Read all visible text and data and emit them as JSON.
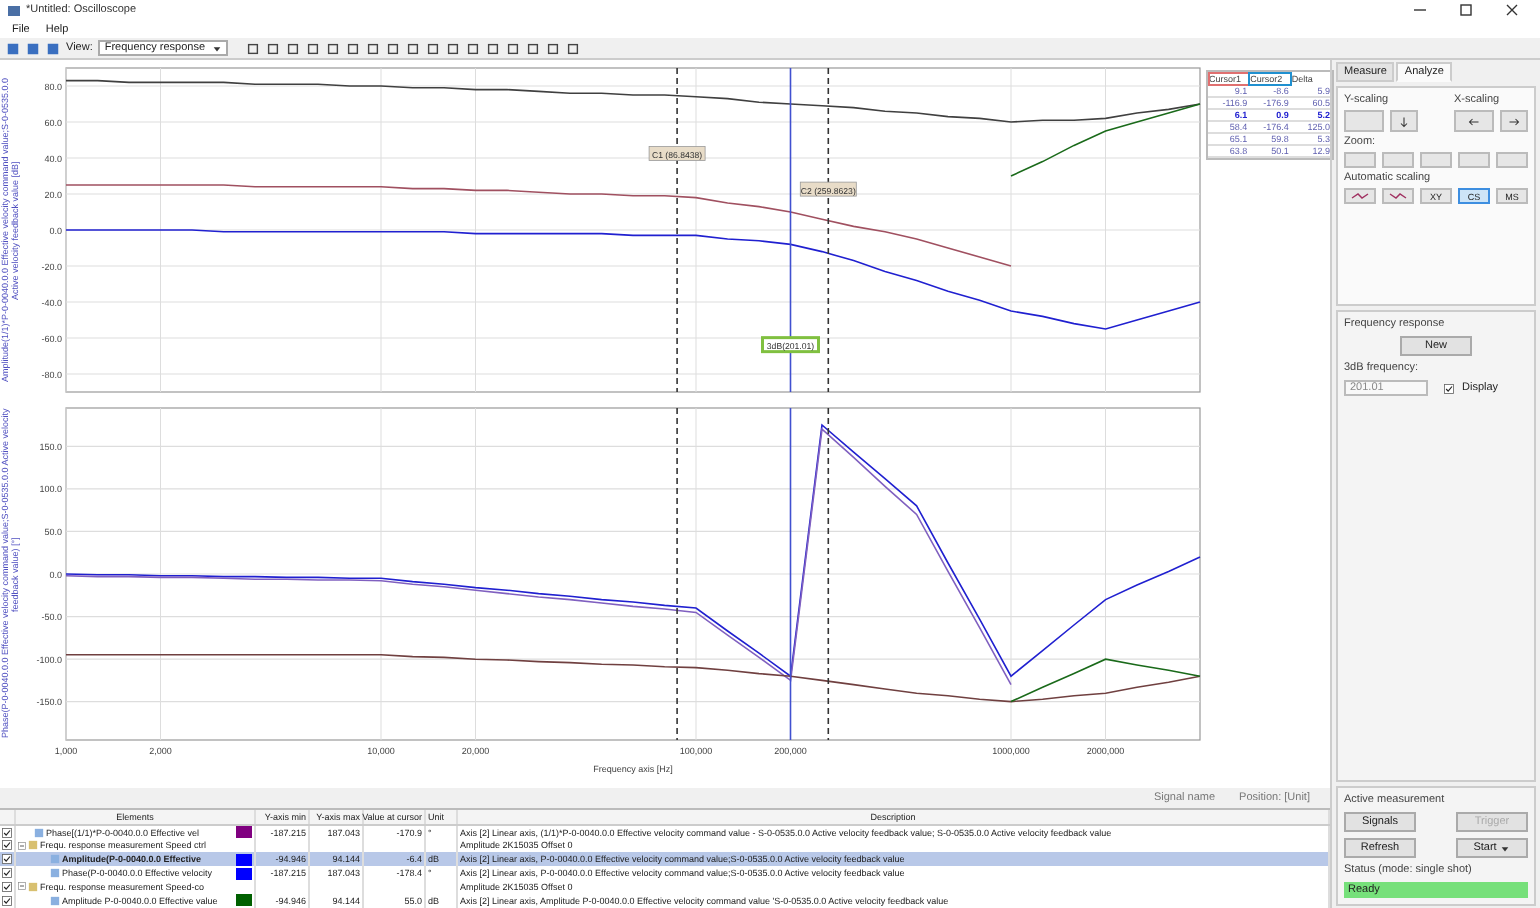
{
  "window": {
    "title": "*Untitled: Oscilloscope"
  },
  "menu": [
    "File",
    "Help"
  ],
  "toolbar": {
    "view_label": "View:",
    "view_value": "Frequency response"
  },
  "amplitude_plot": {
    "cursors": [
      {
        "kind": "cursor",
        "label": "C1 (86.8438)",
        "highlighted": false
      },
      {
        "kind": "cursor",
        "label": "C2 (259.8623)",
        "highlighted": false
      },
      {
        "kind": "marker",
        "label": "3dB(201.01)",
        "highlighted": true
      }
    ],
    "chart_data": {
      "type": "line",
      "ylabel": "Amplitude(1/1)*P-0-0040.0.0 Effective velocity command value;S-0-0535.0.0 Active velocity feedback value [dB]",
      "categories": [
        null,
        null,
        null,
        null,
        null,
        null,
        null,
        null,
        null,
        null,
        null,
        null,
        null,
        null,
        null,
        null,
        null,
        null,
        null,
        null,
        null,
        null,
        null,
        null,
        null,
        null,
        null,
        null,
        null,
        null,
        null,
        null,
        null,
        null,
        null,
        null,
        null
      ],
      "ylim": [
        -90,
        90
      ],
      "grid": true,
      "yticks": [
        {
          "value": 80,
          "label": "80.0"
        },
        {
          "value": 60,
          "label": "60.0"
        },
        {
          "value": 40,
          "label": "40.0"
        },
        {
          "value": 20,
          "label": "20.0"
        },
        {
          "value": 0,
          "label": "0.0"
        },
        {
          "value": -20,
          "label": "-20.0"
        },
        {
          "value": -40,
          "label": "-40.0"
        },
        {
          "value": -60,
          "label": "-60.0"
        },
        {
          "value": -80,
          "label": "-80.0"
        }
      ],
      "series": [
        {
          "color": "#404040",
          "values": [
            83,
            83,
            82,
            82,
            82,
            82,
            81,
            81,
            81,
            80,
            80,
            79,
            79,
            78,
            78,
            77,
            76,
            76,
            75,
            75,
            74,
            73,
            71,
            70,
            69,
            68,
            66,
            65,
            63,
            62,
            60,
            61,
            61,
            62,
            65,
            67,
            70
          ]
        },
        {
          "color": "#a05060",
          "values": [
            25,
            25,
            25,
            25,
            25,
            25,
            24,
            24,
            24,
            24,
            24,
            23,
            23,
            22,
            22,
            21,
            20,
            20,
            19,
            19,
            18,
            15,
            13,
            10,
            6,
            2,
            -1,
            -5,
            -10,
            -15,
            -20,
            null,
            null,
            null,
            null,
            null,
            null
          ]
        },
        {
          "color": "#2020d0",
          "values": [
            0,
            0,
            0,
            0,
            0,
            -1,
            -1,
            -1,
            -1,
            -1,
            -1,
            -1,
            -1,
            -2,
            -2,
            -2,
            -2,
            -2,
            -3,
            -3,
            -3,
            -5,
            -6,
            -8,
            -12,
            -17,
            -23,
            -28,
            -34,
            -39,
            -45,
            -48,
            -52,
            -55,
            -50,
            -45,
            -40
          ]
        },
        {
          "color": "#1a6a1a",
          "values": [
            null,
            null,
            null,
            null,
            null,
            null,
            null,
            null,
            null,
            null,
            null,
            null,
            null,
            null,
            null,
            null,
            null,
            null,
            null,
            null,
            null,
            null,
            null,
            null,
            null,
            null,
            null,
            null,
            null,
            null,
            30,
            38,
            47,
            55,
            60,
            65,
            70
          ]
        }
      ]
    }
  },
  "phase_plot": {
    "chart_data": {
      "type": "line",
      "ylabel": "Phase(P-0-0040.0.0 Effective velocity command value;S-0-0535.0.0 Active velocity feedback value) [°]",
      "xlabel": "Frequency axis [Hz]",
      "categories": [
        "1,000",
        null,
        null,
        "2,000",
        null,
        null,
        null,
        null,
        null,
        null,
        "10,000",
        null,
        null,
        "20,000",
        null,
        null,
        null,
        null,
        null,
        null,
        "100,000",
        null,
        null,
        "200,000",
        null,
        null,
        null,
        null,
        null,
        null,
        "1000,000",
        null,
        null,
        "2000,000",
        null,
        null,
        null
      ],
      "ylim": [
        -195,
        195
      ],
      "grid": true,
      "yticks": [
        {
          "value": 150,
          "label": "150.0"
        },
        {
          "value": 100,
          "label": "100.0"
        },
        {
          "value": 50,
          "label": "50.0"
        },
        {
          "value": 0,
          "label": "0.0"
        },
        {
          "value": -50,
          "label": "-50.0"
        },
        {
          "value": -100,
          "label": "-100.0"
        },
        {
          "value": -150,
          "label": "-150.0"
        }
      ],
      "series": [
        {
          "color": "#2020d0",
          "values": [
            0,
            -1,
            -1,
            -2,
            -2,
            -3,
            -3,
            -4,
            -4,
            -5,
            -5,
            -9,
            -12,
            -16,
            -19,
            -23,
            -26,
            -30,
            -33,
            -37,
            -40,
            -67,
            -93,
            -120,
            175,
            143,
            112,
            80,
            13,
            -53,
            -120,
            -90,
            -60,
            -30,
            -13,
            3,
            20
          ]
        },
        {
          "color": "#8060c0",
          "values": [
            -2,
            -3,
            -3,
            -4,
            -4,
            -5,
            -6,
            -6,
            -7,
            -7,
            -8,
            -12,
            -15,
            -19,
            -23,
            -27,
            -30,
            -34,
            -38,
            -41,
            -45,
            -72,
            -98,
            -125,
            170,
            137,
            103,
            70,
            3,
            -63,
            -130,
            null,
            null,
            null,
            null,
            null,
            null
          ]
        },
        {
          "color": "#704040",
          "values": [
            -95,
            -95,
            -95,
            -95,
            -95,
            -95,
            -95,
            -95,
            -95,
            -95,
            -95,
            -97,
            -98,
            -100,
            -101,
            -103,
            -104,
            -106,
            -107,
            -109,
            -110,
            -113,
            -117,
            -120,
            -125,
            -130,
            -135,
            -140,
            -143,
            -147,
            -150,
            -147,
            -143,
            -140,
            -133,
            -127,
            -120
          ]
        },
        {
          "color": "#1a6a1a",
          "values": [
            null,
            null,
            null,
            null,
            null,
            null,
            null,
            null,
            null,
            null,
            null,
            null,
            null,
            null,
            null,
            null,
            null,
            null,
            null,
            null,
            null,
            null,
            null,
            null,
            null,
            null,
            null,
            null,
            null,
            null,
            -150,
            -133,
            -117,
            -100,
            -107,
            -113,
            -120
          ]
        }
      ]
    }
  },
  "cursor_table": {
    "columns": [
      {
        "label": "Cursor1",
        "color": "#e07070"
      },
      {
        "label": "Cursor2",
        "color": "#2090d0"
      },
      {
        "label": "Delta"
      }
    ],
    "rows": [
      {
        "bold": false,
        "cells": [
          "9.1",
          "-8.6",
          "5.9"
        ]
      },
      {
        "bold": false,
        "cells": [
          "-116.9",
          "-176.9",
          "60.5"
        ]
      },
      {
        "bold": true,
        "cells": [
          "6.1",
          "0.9",
          "5.2"
        ]
      },
      {
        "bold": false,
        "cells": [
          "58.4",
          "-176.4",
          "125.0"
        ]
      },
      {
        "bold": false,
        "cells": [
          "65.1",
          "59.8",
          "5.3"
        ]
      },
      {
        "bold": false,
        "cells": [
          "63.8",
          "50.1",
          "12.9"
        ]
      }
    ]
  },
  "panel": {
    "tabs": [
      {
        "label": "Measure",
        "selected": false
      },
      {
        "label": "Analyze",
        "selected": true
      }
    ],
    "y_scaling": "Y-scaling",
    "x_scaling": "X-scaling",
    "zoom": "Zoom:",
    "auto_scaling": "Automatic scaling",
    "auto_buttons": [
      {
        "label": "XY",
        "selected": false
      },
      {
        "label": "CS",
        "selected": true
      },
      {
        "label": "MS",
        "selected": false
      }
    ],
    "freq_group": "Frequency response",
    "new_button": "New",
    "freq_label": "3dB frequency:",
    "freq_value": "201.01",
    "display": {
      "label": "Display",
      "checked": true
    },
    "active_group": "Active measurement",
    "signals": "Signals",
    "trigger": {
      "label": "Trigger",
      "disabled": true
    },
    "refresh": "Refresh",
    "start": "Start",
    "status_label": "Status (mode: single shot)",
    "status": "Ready"
  },
  "info_bar": {
    "signal_name": "Signal name",
    "position": "Position: [Unit]"
  },
  "table": {
    "columns": [
      "Elements",
      "Y-axis min",
      "Y-axis max",
      "Value at cursor",
      "Unit",
      "Description"
    ],
    "rows": [
      {
        "kind": "signal",
        "checked": true,
        "selected": false,
        "color": "#800080",
        "cells": [
          "Phase[(1/1)*P-0-0040.0.0 Effective vel",
          "-187.215",
          "187.043",
          "-170.9",
          "°",
          "Axis [2] Linear axis, (1/1)*P-0-0040.0.0 Effective velocity command value - S-0-0535.0.0 Active velocity feedback value; S-0-0535.0.0 Active velocity feedback value"
        ]
      },
      {
        "kind": "group",
        "checked": true,
        "selected": false,
        "cells": [
          "Frequ. response measurement Speed ctrl",
          "Amplitude 2K15035 Offset 0"
        ],
        "children": [
          {
            "kind": "signal",
            "checked": true,
            "selected": true,
            "color": "#0000ff",
            "cells": [
              "Amplitude(P-0-0040.0.0 Effective",
              "-94.946",
              "94.144",
              "-6.4",
              "dB",
              "Axis [2] Linear axis, P-0-0040.0.0 Effective velocity command value;S-0-0535.0.0 Active velocity feedback value"
            ]
          },
          {
            "kind": "signal",
            "checked": true,
            "selected": false,
            "color": "#0000ff",
            "cells": [
              "Phase(P-0-0040.0.0 Effective velocity",
              "-187.215",
              "187.043",
              "-178.4",
              "°",
              "Axis [2] Linear axis, P-0-0040.0.0 Effective velocity command value;S-0-0535.0.0 Active velocity feedback value"
            ]
          }
        ]
      },
      {
        "kind": "group",
        "checked": true,
        "selected": false,
        "cells": [
          "Frequ. response measurement Speed-co",
          "Amplitude 2K15035 Offset 0"
        ],
        "children": [
          {
            "kind": "signal",
            "checked": true,
            "selected": false,
            "color": "#006000",
            "cells": [
              "Amplitude P-0-0040.0.0 Effective value",
              "-94.946",
              "94.144",
              "55.0",
              "dB",
              "Axis [2] Linear axis, Amplitude P-0-0040.0.0 Effective velocity command value 'S-0-0535.0.0 Active velocity feedback value"
            ]
          }
        ]
      }
    ]
  }
}
